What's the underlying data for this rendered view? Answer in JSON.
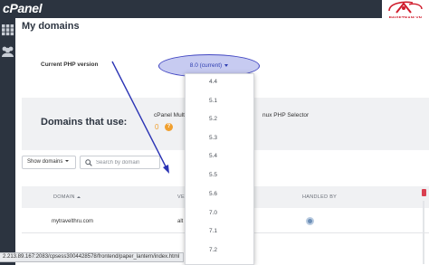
{
  "header": {
    "logo_text": "cPanel",
    "brand_text": "PAVIETNAM.VN"
  },
  "rail": {
    "icons": [
      "grid-icon",
      "users-icon"
    ]
  },
  "page": {
    "title": "My domains"
  },
  "php_version": {
    "label": "Current PHP version",
    "selected": "8.0 (current)",
    "options": [
      "4.4",
      "5.1",
      "5.2",
      "5.3",
      "5.4",
      "5.5",
      "5.6",
      "7.0",
      "7.1",
      "7.2"
    ]
  },
  "domains_panel": {
    "heading": "Domains that use:",
    "multi_text_start": "cPanel Multi I",
    "multi_text_end": "nux PHP Selector",
    "badge_zero": "0"
  },
  "filters": {
    "show_domains_label": "Show domains",
    "search_placeholder": "Search by domain"
  },
  "table": {
    "columns": {
      "domain": "DOMAIN",
      "version": "VE",
      "handled_by": "HANDLED BY"
    },
    "rows": [
      {
        "domain": "mytravelthru.com",
        "version": "alt"
      }
    ]
  },
  "status_bar": {
    "url": "2.213.89.167:2083/cpsess3004428578/frontend/paper_lantern/index.html"
  },
  "colors": {
    "topbar": "#2c3440",
    "highlight_fill": "#c7cbf1",
    "highlight_stroke": "#4146c2",
    "arrow": "#2a33b4",
    "brand_red": "#d01c2c"
  }
}
